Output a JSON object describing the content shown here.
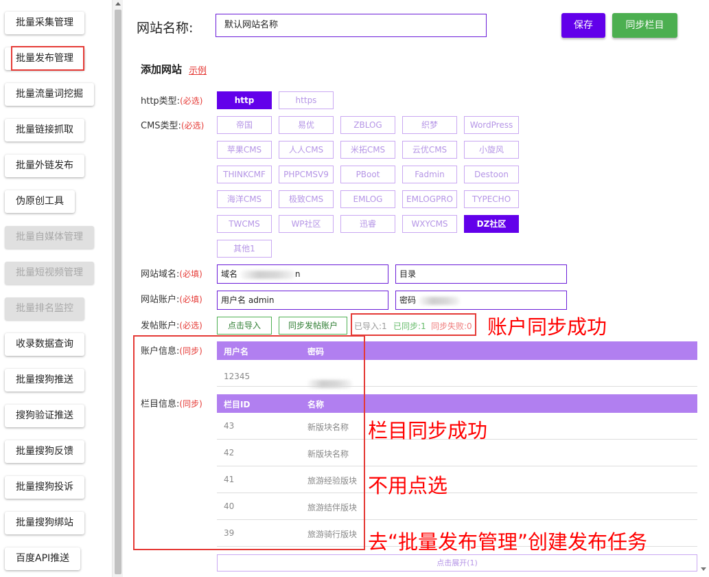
{
  "sidebar": {
    "items": [
      {
        "label": "批量采集管理",
        "disabled": false
      },
      {
        "label": "批量发布管理",
        "disabled": false
      },
      {
        "label": "批量流量词挖掘",
        "disabled": false
      },
      {
        "label": "批量链接抓取",
        "disabled": false
      },
      {
        "label": "批量外链发布",
        "disabled": false
      },
      {
        "label": "伪原创工具",
        "disabled": false
      },
      {
        "label": "批量自媒体管理",
        "disabled": true
      },
      {
        "label": "批量短视频管理",
        "disabled": true
      },
      {
        "label": "批量排名监控",
        "disabled": true
      },
      {
        "label": "收录数据查询",
        "disabled": false
      },
      {
        "label": "批量搜狗推送",
        "disabled": false
      },
      {
        "label": "搜狗验证推送",
        "disabled": false
      },
      {
        "label": "批量搜狗反馈",
        "disabled": false
      },
      {
        "label": "批量搜狗投诉",
        "disabled": false
      },
      {
        "label": "批量搜狗绑站",
        "disabled": false
      },
      {
        "label": "百度API推送",
        "disabled": false
      }
    ]
  },
  "header": {
    "site_name_label": "网站名称:",
    "site_name_value": "默认网站名称",
    "save_label": "保存",
    "sync_label": "同步栏目"
  },
  "add_site": {
    "title": "添加网站",
    "example_link": "示例"
  },
  "http_type": {
    "label": "http类型:",
    "required": "(必选)",
    "options": [
      "http",
      "https"
    ],
    "selected": "http"
  },
  "cms_type": {
    "label": "CMS类型:",
    "required": "(必选)",
    "options": [
      "帝国",
      "易优",
      "ZBLOG",
      "织梦",
      "WordPress",
      "苹果CMS",
      "人人CMS",
      "米拓CMS",
      "云优CMS",
      "小旋风",
      "THINKCMF",
      "PHPCMSV9",
      "PBoot",
      "Fadmin",
      "Destoon",
      "海洋CMS",
      "极致CMS",
      "EMLOG",
      "EMLOGPRO",
      "TYPECHO",
      "TWCMS",
      "WP社区",
      "迅睿",
      "WXYCMS",
      "DZ社区",
      "其他1"
    ],
    "selected": "DZ社区"
  },
  "domain": {
    "label": "网站域名:",
    "required": "(必填)",
    "domain_prefix": "域名",
    "domain_suffix": "n",
    "dir_placeholder": "目录"
  },
  "account": {
    "label": "网站账户:",
    "required": "(必填)",
    "username_prefix": "用户名",
    "username_value": "admin",
    "password_prefix": "密码"
  },
  "post_account": {
    "label": "发帖账户:",
    "required": "(必选)",
    "import_btn": "点击导入",
    "sync_btn": "同步发帖账户",
    "imported": "已导入:1",
    "synced": "已同步:1",
    "failed": "同步失败:0"
  },
  "account_info": {
    "label": "账户信息:",
    "tag": "(同步)",
    "columns": [
      "用户名",
      "密码"
    ],
    "rows": [
      {
        "username": "12345"
      }
    ]
  },
  "column_info": {
    "label": "栏目信息:",
    "tag": "(同步)",
    "columns": [
      "栏目ID",
      "名称"
    ],
    "rows": [
      {
        "id": "43",
        "name": "新版块名称"
      },
      {
        "id": "42",
        "name": "新版块名称"
      },
      {
        "id": "41",
        "name": "旅游经验版块"
      },
      {
        "id": "40",
        "name": "旅游结伴版块"
      },
      {
        "id": "39",
        "name": "旅游骑行版块"
      }
    ],
    "expand_label": "点击展开(1)"
  },
  "annotations": {
    "account_sync_success": "账户同步成功",
    "column_sync_success": "栏目同步成功",
    "no_need_select": "不用点选",
    "goto_publish": "去“批量发布管理”创建发布任务"
  },
  "colors": {
    "primary": "#6200ea",
    "success": "#4caf50",
    "danger": "#e53935",
    "table_header": "#b17ff0",
    "option_border": "#c9a7f2"
  }
}
